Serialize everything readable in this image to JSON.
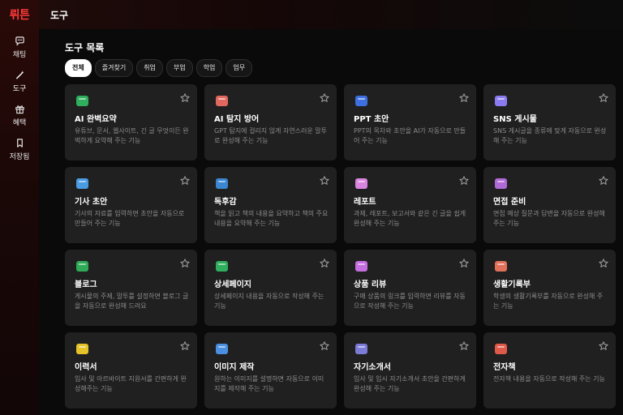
{
  "brand": {
    "name": "뤼튼",
    "color": "#ff3b3b"
  },
  "sidebar": {
    "items": [
      {
        "label": "채팅",
        "icon": "chat-bubble-icon"
      },
      {
        "label": "도구",
        "icon": "magic-wand-icon"
      },
      {
        "label": "혜택",
        "icon": "gift-icon"
      },
      {
        "label": "저장됨",
        "icon": "bookmark-icon"
      }
    ]
  },
  "header": {
    "title": "도구"
  },
  "main": {
    "section_title": "도구 목록",
    "filters": [
      {
        "label": "전체",
        "active": true
      },
      {
        "label": "즐겨찾기",
        "active": false
      },
      {
        "label": "취업",
        "active": false
      },
      {
        "label": "부업",
        "active": false
      },
      {
        "label": "학업",
        "active": false
      },
      {
        "label": "업무",
        "active": false
      }
    ],
    "tools": [
      {
        "title": "AI 완벽요약",
        "desc": "유튜브, 문서, 웹사이트, 긴 글 무엇이든 완벽하게 요약해 주는 기능",
        "icon": "summary-icon",
        "color": "#2fae5e"
      },
      {
        "title": "AI 탐지 방어",
        "desc": "GPT 탐지에 걸리지 않게 자연스러운 말투로 완성해 주는 기능",
        "icon": "shield-icon",
        "color": "#e0685f"
      },
      {
        "title": "PPT 초안",
        "desc": "PPT의 목차와 초안을 AI가 자동으로 만들어 주는 기능",
        "icon": "presentation-icon",
        "color": "#3d6fe0"
      },
      {
        "title": "SNS 게시물",
        "desc": "SNS 게시글을 종류에 맞게 자동으로 완성해 주는 기능",
        "icon": "phone-icon",
        "color": "#8a7cf0"
      },
      {
        "title": "기사 초안",
        "desc": "기사의 자료를 입력하면 초안을 자동으로 만들어 주는 기능",
        "icon": "newspaper-icon",
        "color": "#4a9be0"
      },
      {
        "title": "독후감",
        "desc": "책을 읽고 책의 내용을 요약하고 책의 주요 내용을 요약해 주는 기능",
        "icon": "book-icon",
        "color": "#3a86d1"
      },
      {
        "title": "레포트",
        "desc": "과제, 레포트, 보고서와 같은 긴 글을 쉽게 완성해 주는 기능",
        "icon": "report-icon",
        "color": "#d985e0"
      },
      {
        "title": "면접 준비",
        "desc": "면접 예상 질문과 답변을 자동으로 완성해 주는 기능",
        "icon": "briefcase-icon",
        "color": "#b06ad6"
      },
      {
        "title": "블로그",
        "desc": "게시물의 주제, 말투를 설정하면 블로그 글을 자동으로 완성해 드려요",
        "icon": "blog-icon",
        "color": "#2faa58"
      },
      {
        "title": "상세페이지",
        "desc": "상세페이지 내용을 자동으로 작성해 주는 기능",
        "icon": "store-icon",
        "color": "#2fae5e"
      },
      {
        "title": "상품 리뷰",
        "desc": "구매 상품의 링크를 입력하면 리뷰를 자동으로 작성해 주는 기능",
        "icon": "review-icon",
        "color": "#c56ee0"
      },
      {
        "title": "생활기록부",
        "desc": "학생의 생활기록부를 자동으로 완성해 주는 기능",
        "icon": "school-icon",
        "color": "#e0705a"
      },
      {
        "title": "이력서",
        "desc": "입사 및 아르바이트 지원서를 간편하게 완성해주는 기능",
        "icon": "resume-icon",
        "color": "#e6c229"
      },
      {
        "title": "이미지 제작",
        "desc": "원하는 이미지를 설명하면 자동으로 이미지를 제작해 주는 기능",
        "icon": "image-icon",
        "color": "#4b8fe0"
      },
      {
        "title": "자기소개서",
        "desc": "입사 및 입시 자기소개서 초안을 간편하게 완성해 주는 기능",
        "icon": "self-intro-icon",
        "color": "#7d7bd8"
      },
      {
        "title": "전자책",
        "desc": "전자책 내용을 자동으로 작성해 주는 기능",
        "icon": "ebook-icon",
        "color": "#e05a4a"
      }
    ]
  }
}
